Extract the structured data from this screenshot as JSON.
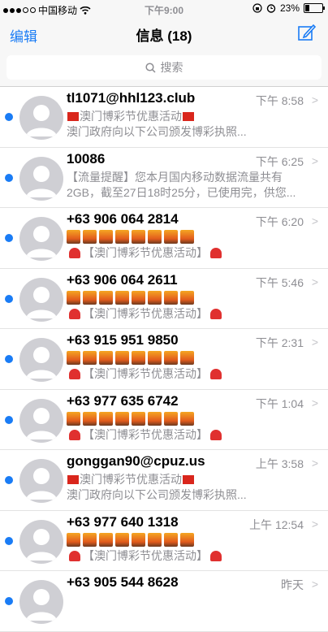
{
  "status_bar": {
    "carrier": "中国移动",
    "time": "下午9:00",
    "battery": "23%",
    "battery_level": 0.23
  },
  "nav": {
    "edit": "编辑",
    "title": "信息 (18)"
  },
  "search": {
    "placeholder": "搜索"
  },
  "messages": [
    {
      "sender": "tl1071@hhl123.club",
      "time": "下午 8:58",
      "line1": "澳门博彩节优惠活动",
      "line2": "澳门政府向以下公司颁发博彩执照..."
    },
    {
      "sender": "10086",
      "time": "下午 6:25",
      "line1": "【流量提醒】您本月国内移动数据流量共有",
      "line2": "2GB，截至27日18时25分，已使用完，供您..."
    },
    {
      "sender": "+63 906 064 2814",
      "time": "下午 6:20",
      "line2": "【澳门博彩节优惠活动】"
    },
    {
      "sender": "+63 906 064 2611",
      "time": "下午 5:46",
      "line2": "【澳门博彩节优惠活动】"
    },
    {
      "sender": "+63 915 951 9850",
      "time": "下午 2:31",
      "line2": "【澳门博彩节优惠活动】"
    },
    {
      "sender": "+63 977 635 6742",
      "time": "下午 1:04",
      "line2": "【澳门博彩节优惠活动】"
    },
    {
      "sender": "gonggan90@cpuz.us",
      "time": "上午 3:58",
      "line1": "澳门博彩节优惠活动",
      "line2": "澳门政府向以下公司颁发博彩执照..."
    },
    {
      "sender": "+63 977 640 1318",
      "time": "上午 12:54",
      "line2": "【澳门博彩节优惠活动】"
    },
    {
      "sender": "+63 905 544 8628",
      "time": "昨天"
    }
  ],
  "colors": {
    "accent": "#1a7cf5"
  }
}
